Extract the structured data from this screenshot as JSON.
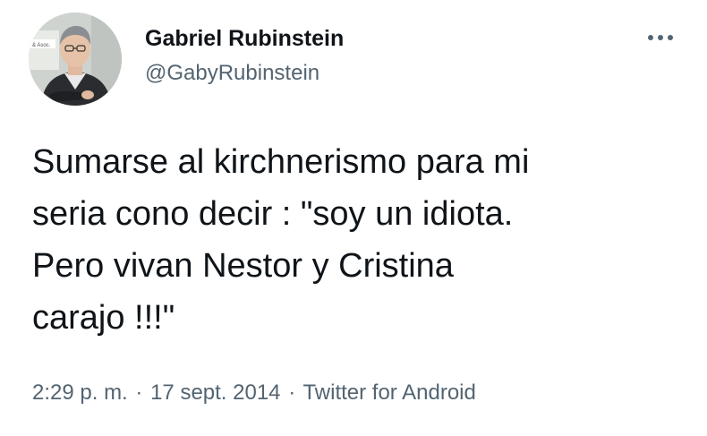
{
  "author": {
    "display_name": "Gabriel Rubinstein",
    "handle": "@GabyRubinstein",
    "avatar_icon": "person-portrait-icon",
    "avatar_sign_text": "& Asoc."
  },
  "menu": {
    "more_label": "•••"
  },
  "tweet": {
    "text_lines": [
      "Sumarse al kirchnerismo para mi",
      "seria cono decir : \"soy un idiota.",
      "Pero vivan Nestor y Cristina",
      "carajo !!!\""
    ]
  },
  "meta": {
    "time": "2:29 p. m.",
    "separator": "·",
    "date": "17 sept. 2014",
    "source": "Twitter for Android"
  },
  "colors": {
    "text_primary": "#0f1419",
    "text_secondary": "#536471"
  }
}
